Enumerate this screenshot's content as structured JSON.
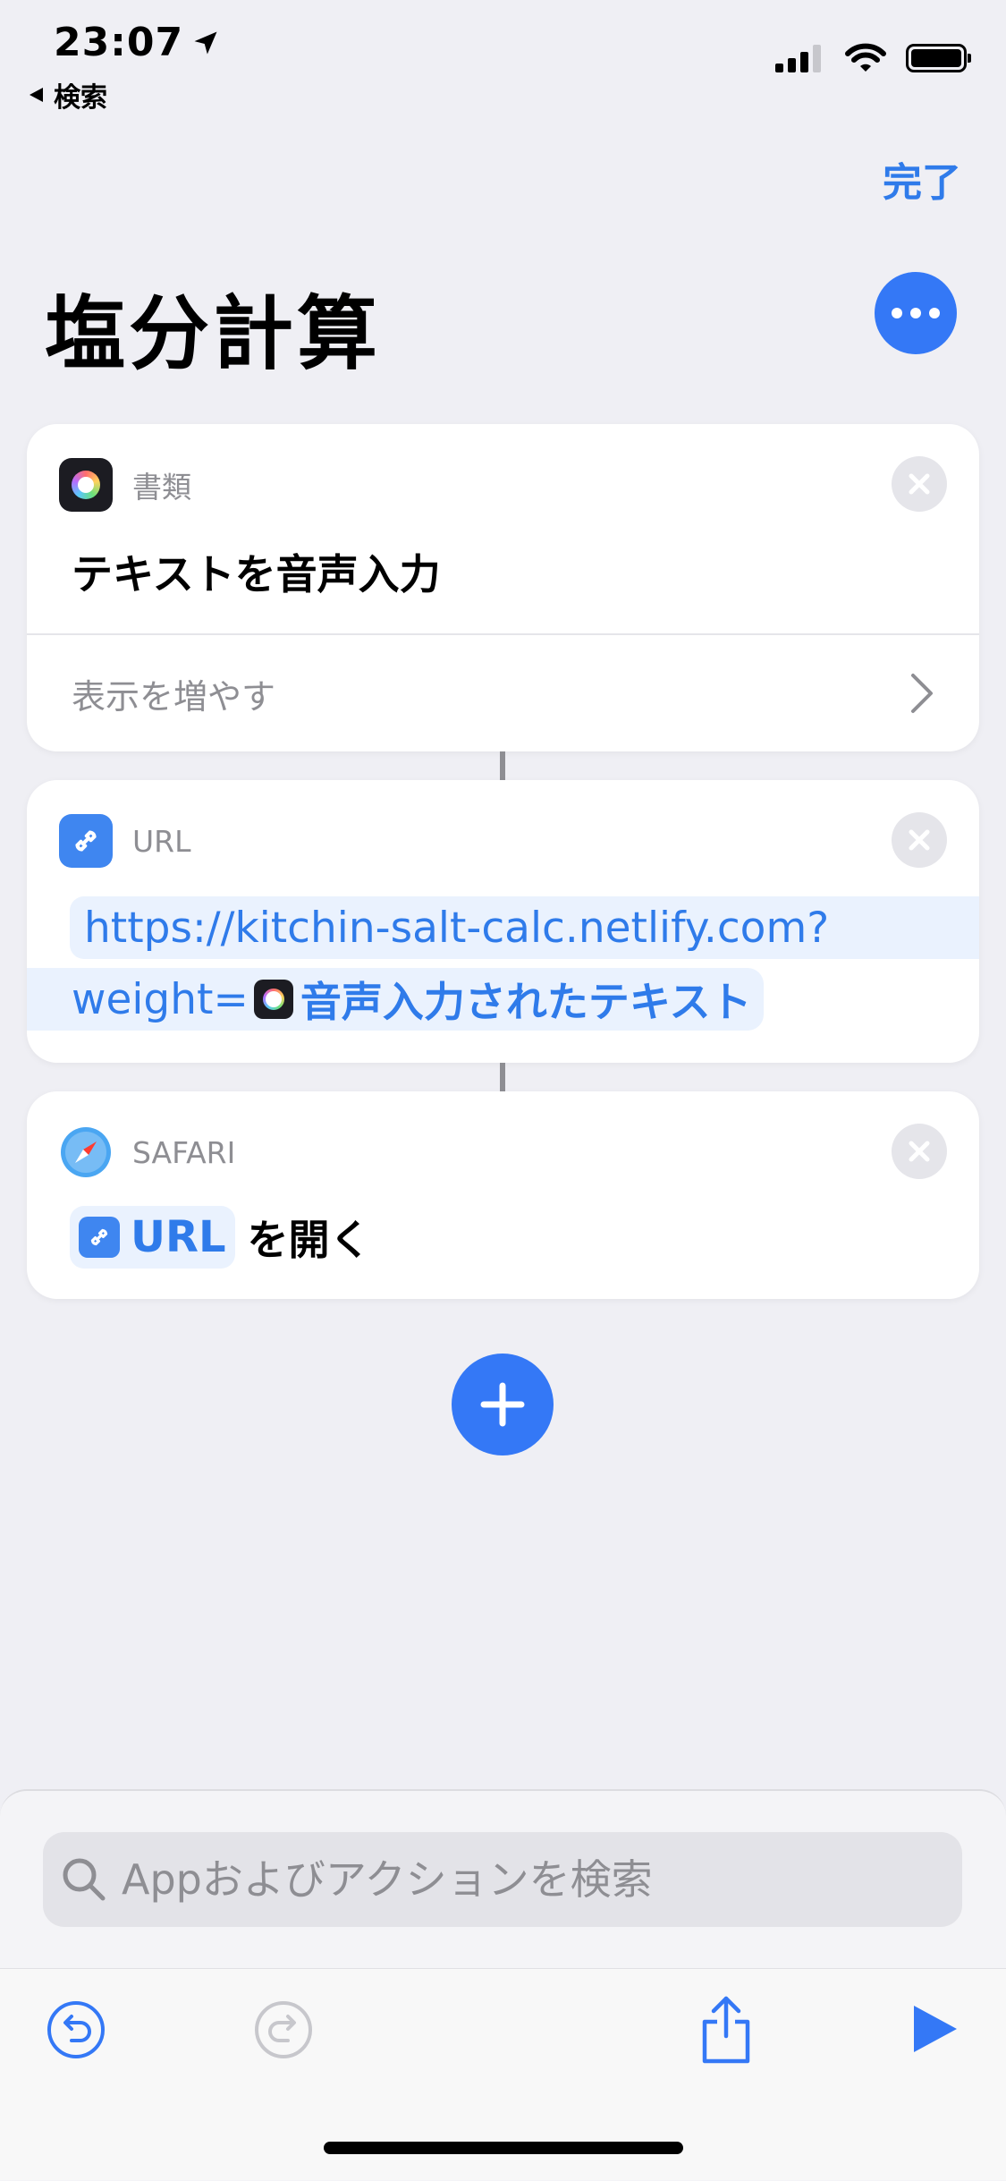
{
  "status_bar": {
    "time": "23:07",
    "back_label": "検索"
  },
  "nav": {
    "done_label": "完了",
    "title": "塩分計算"
  },
  "cards": [
    {
      "category": "書類",
      "title": "テキストを音声入力",
      "show_more_label": "表示を増やす"
    },
    {
      "category": "URL",
      "url_line1": "https://kitchin-salt-calc.netlify.com?",
      "url_line2_prefix": "weight=",
      "variable_label": "音声入力されたテキスト"
    },
    {
      "category": "SAFARI",
      "variable_label": "URL",
      "action_suffix": "を開く"
    }
  ],
  "search": {
    "placeholder": "Appおよびアクションを検索"
  },
  "colors": {
    "accent": "#3478F6",
    "background": "#EFEFF4"
  },
  "icons": [
    "location-arrow-icon",
    "back-arrow-icon",
    "cellular-signal-icon",
    "wifi-icon",
    "battery-icon",
    "more-dots-icon",
    "documents-app-icon",
    "close-icon",
    "chevron-right-icon",
    "link-icon",
    "safari-compass-icon",
    "plus-icon",
    "search-icon",
    "undo-icon",
    "redo-icon",
    "share-icon",
    "play-icon"
  ]
}
